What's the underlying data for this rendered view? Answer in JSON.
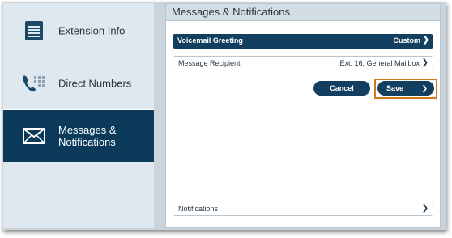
{
  "sidebar": {
    "items": [
      {
        "label": "Extension Info",
        "icon": "extension-info-icon",
        "active": false
      },
      {
        "label": "Direct Numbers",
        "icon": "phone-keypad-icon",
        "active": false
      },
      {
        "label": "Messages & Notifications",
        "icon": "envelope-icon",
        "active": true
      }
    ]
  },
  "main": {
    "title": "Messages & Notifications",
    "voicemail": {
      "label": "Voicemail Greeting",
      "value": "Custom"
    },
    "recipient": {
      "label": "Message Recipient",
      "value": "Ext. 16, General Mailbox"
    },
    "cancel_label": "Cancel",
    "save_label": "Save",
    "notifications_label": "Notifications"
  },
  "colors": {
    "accent": "#0b3a5b",
    "highlight": "#d07a1d"
  }
}
